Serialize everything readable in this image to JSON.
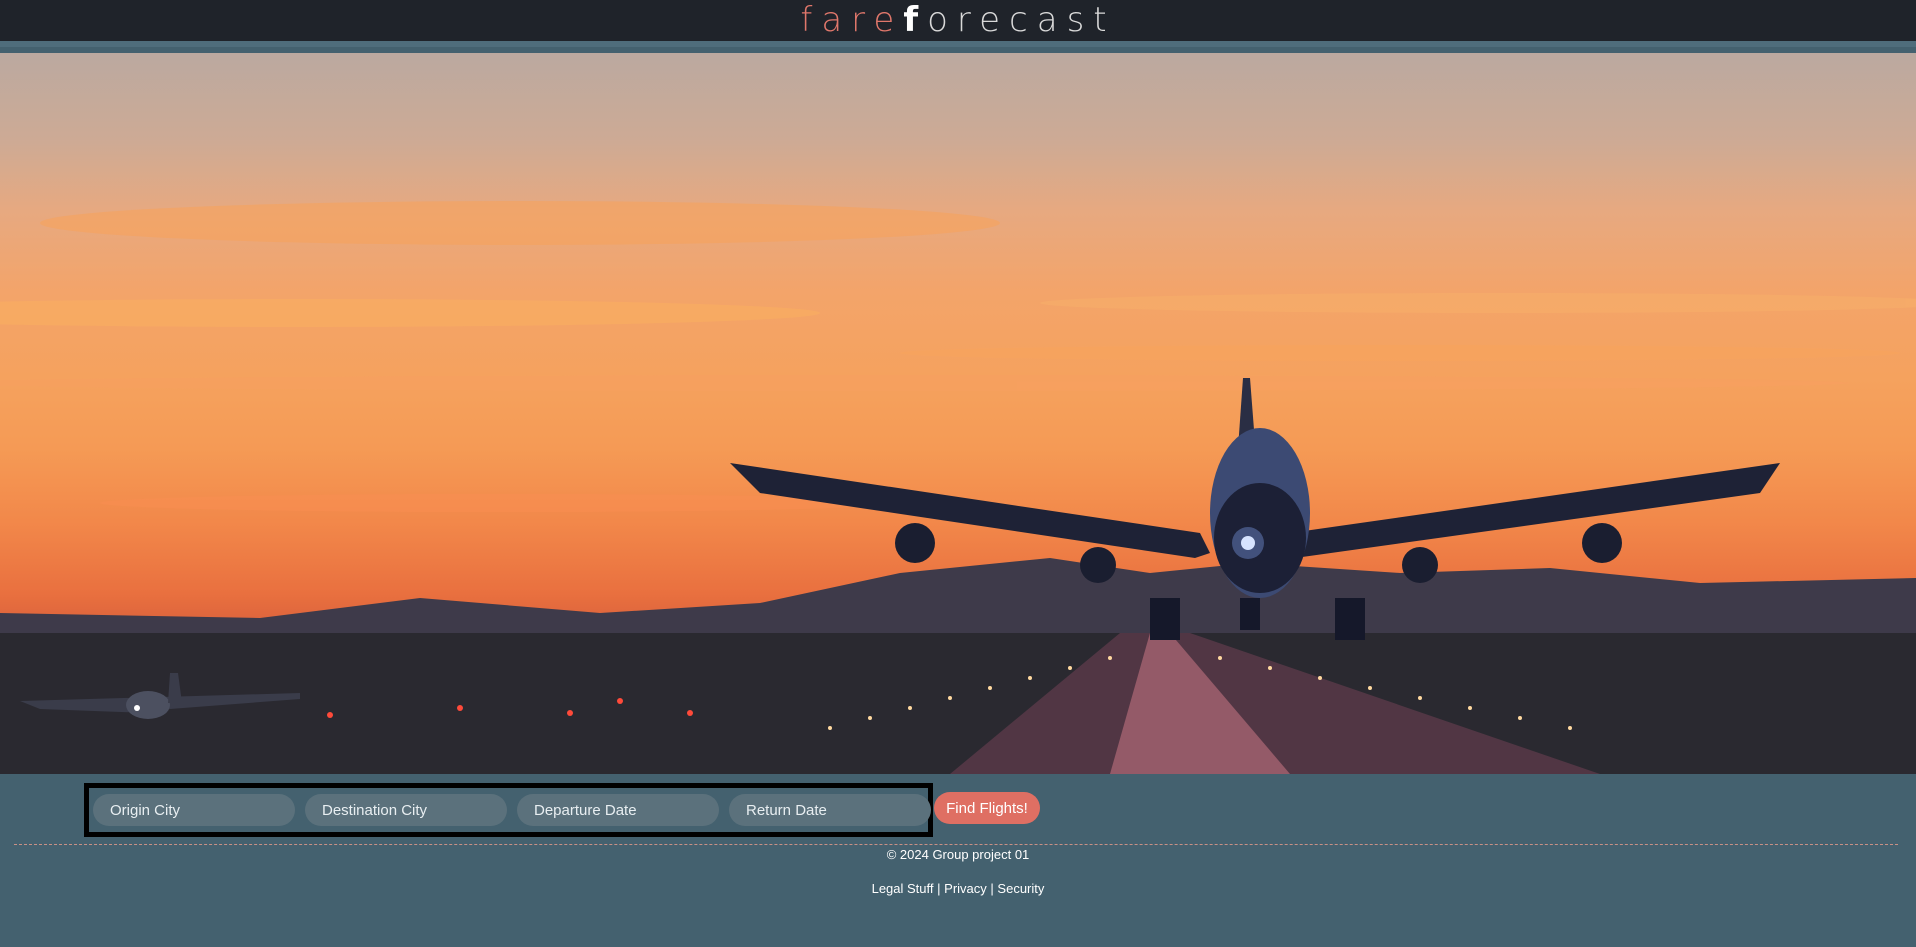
{
  "header": {
    "logo_part1": "fare",
    "logo_part2_first": "f",
    "logo_part2_rest": "orecast"
  },
  "search": {
    "origin_placeholder": "Origin City",
    "destination_placeholder": "Destination City",
    "departure_placeholder": "Departure Date",
    "return_placeholder": "Return Date",
    "submit_label": "Find Flights!"
  },
  "footer": {
    "copyright": "© 2024 Group project 01",
    "links": [
      "Legal Stuff",
      "Privacy",
      "Security"
    ],
    "separator": "|"
  },
  "colors": {
    "header_bg": "#1f232a",
    "body_bg": "#44616f",
    "accent": "#df6f63",
    "field_bg": "#5b717c"
  },
  "hero_image": "sunset-airplane-landing"
}
